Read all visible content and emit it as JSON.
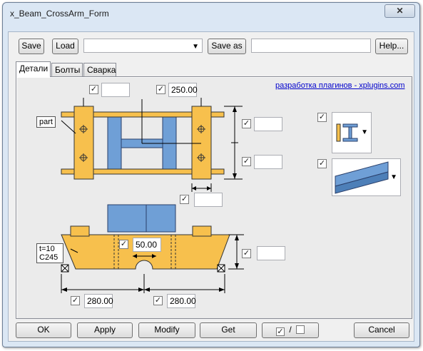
{
  "window": {
    "title": "x_Beam_CrossArm_Form",
    "close_glyph": "✕"
  },
  "toolbar": {
    "save_label": "Save",
    "load_label": "Load",
    "attributes_combo_value": "",
    "save_as_label": "Save as",
    "save_as_value": "",
    "help_label": "Help..."
  },
  "tabs": [
    {
      "label": "Детали",
      "active": true
    },
    {
      "label": "Болты",
      "active": false
    },
    {
      "label": "Сварка",
      "active": false
    }
  ],
  "details": {
    "link_text": "разработка плагинов - xplugins.com",
    "part_label": "part",
    "plate_note_line1": "t=10",
    "plate_note_line2": "С245",
    "fields": {
      "top_left": "",
      "top_right": "250.00",
      "right_upper": "",
      "right_lower": "",
      "under_plan": "",
      "elev_center": "50.00",
      "elev_right": "",
      "bottom_left": "280.00",
      "bottom_right": "280.00"
    },
    "checks": {
      "top_left": "✓",
      "top_right": "✓",
      "right_upper": "✓",
      "right_lower": "✓",
      "under_plan": "✓",
      "elev_center": "✓",
      "elev_right": "✓",
      "bottom_left": "✓",
      "bottom_right": "✓",
      "profile_picker": "✓",
      "orientation_picker": "✓"
    },
    "profile_icon": "i-beam-section-icon",
    "orientation_icon": "beam-orientation-icon"
  },
  "footer": {
    "ok_label": "OK",
    "apply_label": "Apply",
    "modify_label": "Modify",
    "get_label": "Get",
    "toggle_check_glyph": "✓",
    "toggle_slash": "/",
    "cancel_label": "Cancel"
  },
  "colors": {
    "plate": "#f7c04d",
    "beam": "#6f9fd6",
    "link": "#0000cc"
  }
}
